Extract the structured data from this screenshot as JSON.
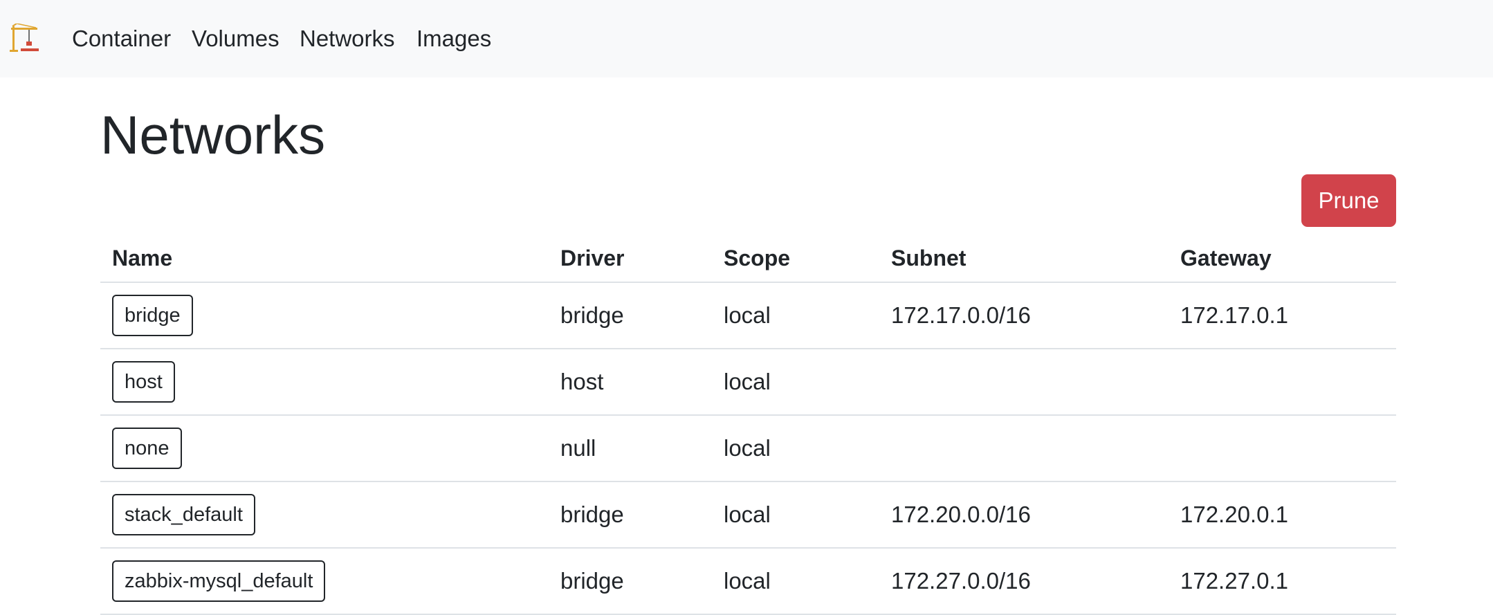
{
  "nav": {
    "logo_icon": "crane-icon",
    "links": [
      "Container",
      "Volumes",
      "Networks",
      "Images"
    ]
  },
  "page": {
    "title": "Networks",
    "prune_label": "Prune",
    "prune_color": "#d1434b"
  },
  "table": {
    "headers": [
      "Name",
      "Driver",
      "Scope",
      "Subnet",
      "Gateway"
    ],
    "rows": [
      {
        "name": "bridge",
        "driver": "bridge",
        "scope": "local",
        "subnet": "172.17.0.0/16",
        "gateway": "172.17.0.1"
      },
      {
        "name": "host",
        "driver": "host",
        "scope": "local",
        "subnet": "",
        "gateway": ""
      },
      {
        "name": "none",
        "driver": "null",
        "scope": "local",
        "subnet": "",
        "gateway": ""
      },
      {
        "name": "stack_default",
        "driver": "bridge",
        "scope": "local",
        "subnet": "172.20.0.0/16",
        "gateway": "172.20.0.1"
      },
      {
        "name": "zabbix-mysql_default",
        "driver": "bridge",
        "scope": "local",
        "subnet": "172.27.0.0/16",
        "gateway": "172.27.0.1"
      }
    ]
  }
}
